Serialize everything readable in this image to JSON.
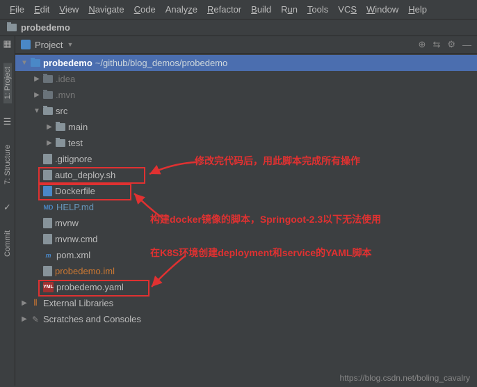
{
  "menu": [
    "File",
    "Edit",
    "View",
    "Navigate",
    "Code",
    "Analyze",
    "Refactor",
    "Build",
    "Run",
    "Tools",
    "VCS",
    "Window",
    "Help"
  ],
  "breadcrumb": {
    "project": "probedemo"
  },
  "sideTabs": {
    "project": "1: Project",
    "structure": "7: Structure",
    "commit": "Commit"
  },
  "panel": {
    "title": "Project"
  },
  "tree": {
    "root": {
      "name": "probedemo",
      "path": "~/github/blog_demos/probedemo"
    },
    "items": [
      {
        "name": ".idea"
      },
      {
        "name": ".mvn"
      },
      {
        "name": "src"
      },
      {
        "name": "main"
      },
      {
        "name": "test"
      },
      {
        "name": ".gitignore"
      },
      {
        "name": "auto_deploy.sh"
      },
      {
        "name": "Dockerfile"
      },
      {
        "name": "HELP.md"
      },
      {
        "name": "mvnw"
      },
      {
        "name": "mvnw.cmd"
      },
      {
        "name": "pom.xml"
      },
      {
        "name": "probedemo.iml"
      },
      {
        "name": "probedemo.yaml"
      }
    ],
    "externalLibs": "External Libraries",
    "scratches": "Scratches and Consoles"
  },
  "annotations": {
    "a1": "修改完代码后，用此脚本完成所有操作",
    "a2": "构建docker镜像的脚本，Springoot-2.3以下无法使用",
    "a3": "在K8S环境创建deployment和service的YAML脚本"
  },
  "watermark": "https://blog.csdn.net/boling_cavalry"
}
